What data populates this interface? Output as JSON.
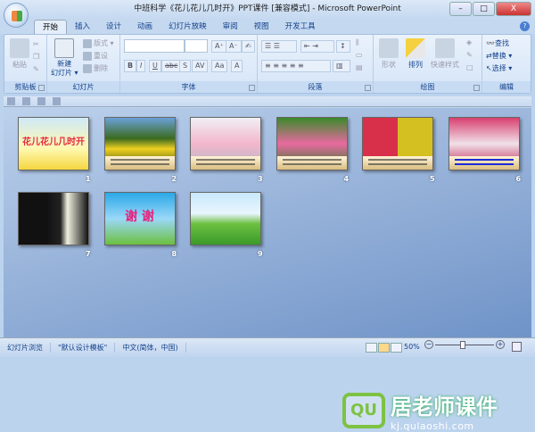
{
  "window": {
    "title": "中班科学《花儿花儿几时开》PPT课件 [兼容模式] - Microsoft PowerPoint",
    "minimize": "–",
    "maximize": "□",
    "close": "X"
  },
  "tabs": [
    {
      "label": "开始",
      "active": true
    },
    {
      "label": "插入"
    },
    {
      "label": "设计"
    },
    {
      "label": "动画"
    },
    {
      "label": "幻灯片放映"
    },
    {
      "label": "审阅"
    },
    {
      "label": "视图"
    },
    {
      "label": "开发工具"
    }
  ],
  "ribbon": {
    "clipboard": {
      "label": "剪贴板",
      "paste": "粘贴"
    },
    "slides": {
      "label": "幻灯片",
      "new_slide": "新建\n幻灯片 ▾",
      "layout": "版式 ▾",
      "reset": "重设",
      "delete": "删除"
    },
    "font": {
      "label": "字体",
      "font_name": "",
      "font_size": "",
      "grow": "A⁺",
      "shrink": "A⁻",
      "bold": "B",
      "italic": "I",
      "underline": "U",
      "strike": "abc",
      "shadow": "S",
      "spacing": "AV",
      "case": "Aa",
      "color": "A"
    },
    "paragraph": {
      "label": "段落"
    },
    "drawing": {
      "label": "绘图",
      "shapes": "形状",
      "arrange": "排列",
      "quick_styles": "快速样式"
    },
    "editing": {
      "label": "编辑",
      "find": "查找",
      "replace": "替换 ▾",
      "select": "选择 ▾"
    }
  },
  "slides": [
    {
      "number": "1",
      "title": "花儿花儿几时开",
      "bg": "linear-gradient(#cfe9f7,#fff8b0 60%,#f5d640)"
    },
    {
      "number": "2",
      "bg": "linear-gradient(#6aa0d8,#3b6b1f 40%,#f0d020 60%,#2e4e12)",
      "caption": true
    },
    {
      "number": "3",
      "bg": "linear-gradient(#f0f0f4,#f3b6cc 50%,#b0b8c4)",
      "caption": true
    },
    {
      "number": "4",
      "bg": "linear-gradient(#3a8a2a,#e86aa0 50%,#2c7a24)",
      "caption": true
    },
    {
      "number": "5",
      "bg": "linear-gradient(90deg,#d8304a 50%,#d4c020 50%)",
      "caption": true
    },
    {
      "number": "6",
      "bg": "linear-gradient(#d84070,#f0e0e8 50%,#c02050)",
      "caption": true,
      "caption_color": "#1b2bd8"
    },
    {
      "number": "7",
      "bg": "linear-gradient(90deg,#111 40%,#222 60%,#f0f0e0 70%,#111)"
    },
    {
      "number": "8",
      "title": "谢 谢",
      "bg": "linear-gradient(#2aa8e8,#9ad8f8 50%,#6cc040)"
    },
    {
      "number": "9",
      "bg": "linear-gradient(#c8e8fa,#e8f6ff 40%,#6cc040 60%,#3a9a2a)"
    }
  ],
  "watermark": {
    "logo": "QU",
    "name": "居老师课件",
    "url": "kj.qulaoshi.com"
  },
  "status": {
    "view": "幻灯片浏览",
    "theme": "\"默认设计模板\"",
    "language": "中文(简体，中国)",
    "zoom": "50%",
    "zoom_minus": "−",
    "zoom_plus": "+"
  },
  "colors": {
    "slide1_title": "#e8283c",
    "slide8_title": "#e8207a"
  }
}
